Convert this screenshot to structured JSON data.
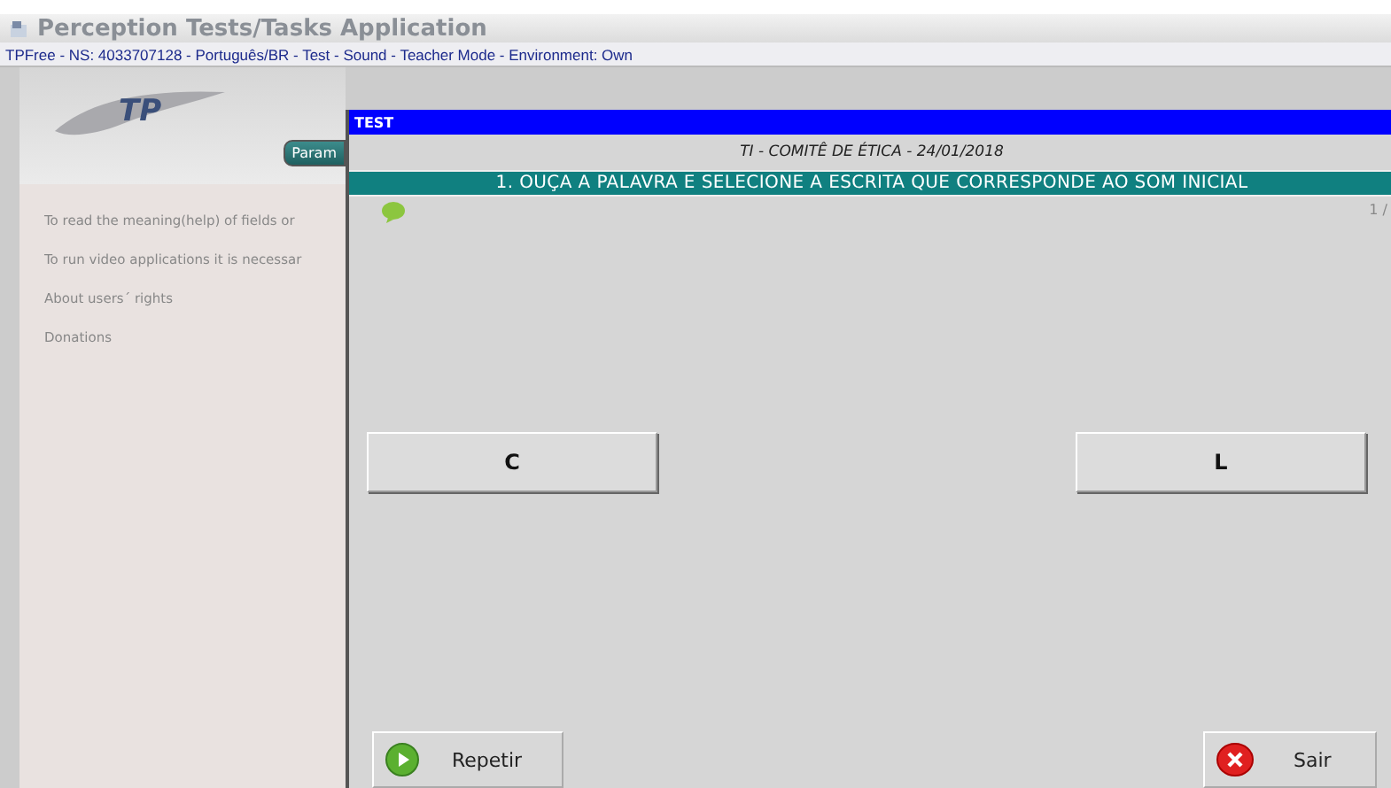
{
  "window": {
    "title": "Perception Tests/Tasks Application"
  },
  "status_line": "TPFree - NS: 4033707128 - Português/BR - Test - Sound - Teacher Mode - Environment: Own",
  "sidebar": {
    "logo": "TP",
    "tab": "Param",
    "items": [
      "To read the meaning(help) of fields or",
      "To run video applications it is necessar",
      "About users´ rights",
      "Donations"
    ]
  },
  "dialog": {
    "title": "TEST",
    "subtitle": "TI - COMITÊ DE ÉTICA - 24/01/2018",
    "question": "1. OUÇA A PALAVRA E SELECIONE A ESCRITA QUE CORRESPONDE AO SOM INICIAL",
    "counter": "1 /",
    "options": [
      {
        "label": "C"
      },
      {
        "label": "L"
      }
    ],
    "actions": [
      {
        "label": "Repetir",
        "kind": "play"
      },
      {
        "label": "Sair",
        "kind": "close"
      }
    ]
  }
}
